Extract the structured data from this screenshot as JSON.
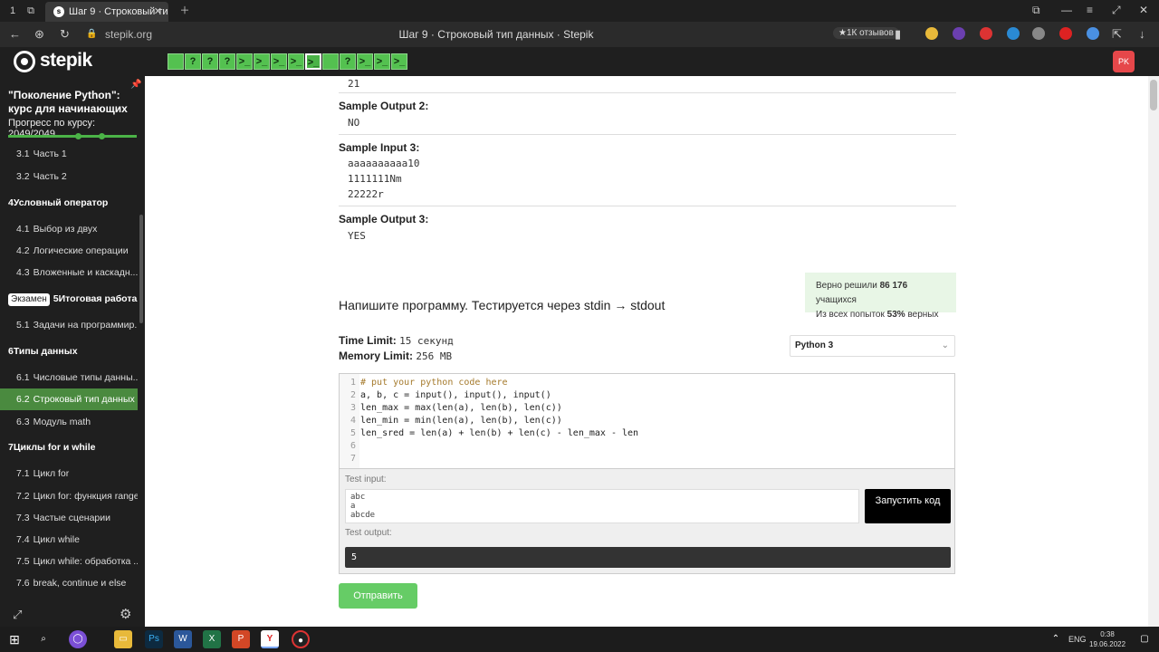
{
  "browser": {
    "tab_title": "Шаг 9 · Строковый тип",
    "url": "stepik.org",
    "page_title": "Шаг 9 · Строковый тип данных · Stepik",
    "reviews": "★1К отзывов"
  },
  "header": {
    "logo": "stepik",
    "avatar": "PK",
    "steps": [
      "",
      "?",
      "?",
      "?",
      ">_",
      ">_",
      ">_",
      ">_",
      ">_",
      "",
      "?",
      ">_",
      ">_",
      ">_"
    ]
  },
  "sidebar": {
    "course_title": "\"Поколение Python\": курс для начинающих",
    "progress_label": "Прогресс по курсу:  2049/2049",
    "items": [
      {
        "type": "lesson",
        "num": "3.1",
        "label": "Часть 1"
      },
      {
        "type": "lesson",
        "num": "3.2",
        "label": "Часть 2"
      },
      {
        "type": "module",
        "num": "4",
        "label": "Условный оператор"
      },
      {
        "type": "lesson",
        "num": "4.1",
        "label": "Выбор из двух"
      },
      {
        "type": "lesson",
        "num": "4.2",
        "label": "Логические операции"
      },
      {
        "type": "lesson",
        "num": "4.3",
        "label": "Вложенные и каскадн..."
      },
      {
        "type": "module",
        "badge": "Экзамен",
        "num": "5",
        "label": "Итоговая работа..."
      },
      {
        "type": "lesson",
        "num": "5.1",
        "label": "Задачи на программир..."
      },
      {
        "type": "module",
        "num": "6",
        "label": "Типы данных"
      },
      {
        "type": "lesson",
        "num": "6.1",
        "label": "Числовые типы данны..."
      },
      {
        "type": "lesson",
        "num": "6.2",
        "label": "Строковый тип данных"
      },
      {
        "type": "lesson",
        "num": "6.3",
        "label": "Модуль math"
      },
      {
        "type": "module",
        "num": "7",
        "label": "Циклы for и while"
      },
      {
        "type": "lesson",
        "num": "7.1",
        "label": "Цикл for"
      },
      {
        "type": "lesson",
        "num": "7.2",
        "label": "Цикл for: функция range"
      },
      {
        "type": "lesson",
        "num": "7.3",
        "label": "Частые сценарии"
      },
      {
        "type": "lesson",
        "num": "7.4",
        "label": "Цикл while"
      },
      {
        "type": "lesson",
        "num": "7.5",
        "label": "Цикл while: обработка ..."
      },
      {
        "type": "lesson",
        "num": "7.6",
        "label": "break, continue и else"
      }
    ]
  },
  "samples": {
    "prev_value": "21",
    "output2_label": "Sample Output 2:",
    "output2_value": "NO",
    "input3_label": "Sample Input 3:",
    "input3_lines": [
      "aaaaaaaaaa10",
      "1111111Nm",
      "22222r"
    ],
    "output3_label": "Sample Output 3:",
    "output3_value": "YES"
  },
  "stats": {
    "solved_prefix": "Верно решили",
    "solved_count": "86 176",
    "solved_suffix": "учащихся",
    "attempts_prefix": "Из всех попыток",
    "attempts_pct": "53%",
    "attempts_suffix": "верных"
  },
  "task": {
    "heading": "Напишите программу. Тестируется через stdin → stdout",
    "time_limit_label": "Time Limit:",
    "time_limit_value": "15 секунд",
    "memory_limit_label": "Memory Limit:",
    "memory_limit_value": "256 MB",
    "language": "Python 3"
  },
  "editor": {
    "lines": [
      "# put your python code here",
      "a, b, c = input(), input(), input()",
      "len_max = max(len(a), len(b), len(c))",
      "len_min = min(len(a), len(b), len(c))",
      "len_sred = len(a) + len(b) + len(c) - len_max - len",
      "",
      ""
    ]
  },
  "io": {
    "test_input_label": "Test input:",
    "test_input_value": "abc\na\nabcde",
    "run_button": "Запустить код",
    "test_output_label": "Test output:",
    "test_output_value": "5",
    "submit_button": "Отправить"
  },
  "taskbar": {
    "lang": "ENG",
    "time": "0:38",
    "date": "19.06.2022"
  }
}
